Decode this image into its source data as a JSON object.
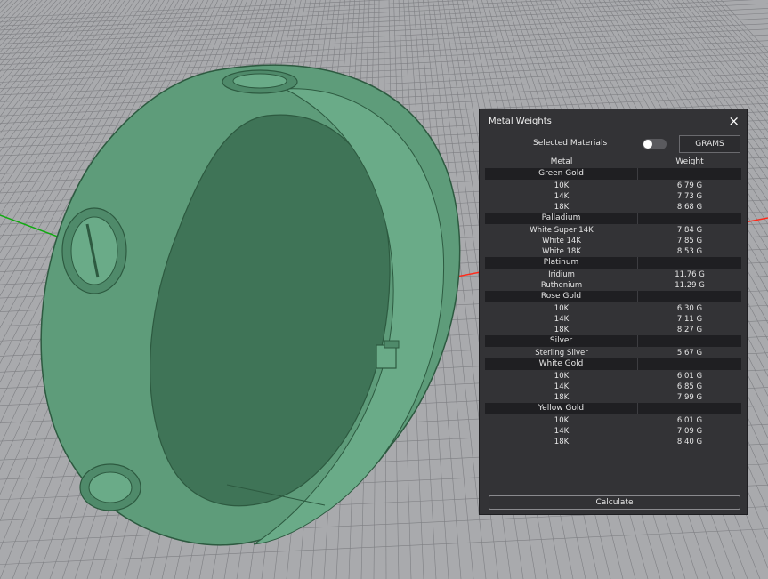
{
  "viewport": {
    "background": "#a9aaad",
    "grid_color": "#7e7f83",
    "ring_color": "#5e9c7a",
    "ring_outline": "#2d5a40",
    "axis_x_color": "#ff2a1a",
    "axis_y_color": "#11aa11"
  },
  "panel": {
    "title": "Metal Weights",
    "close_icon": "×",
    "selected_materials_label": "Selected Materials",
    "toggle_on": false,
    "units_button": "GRAMS",
    "header": {
      "metal": "Metal",
      "weight": "Weight"
    },
    "groups": [
      {
        "name": "Green Gold",
        "items": [
          {
            "metal": "10K",
            "weight": "6.79 G"
          },
          {
            "metal": "14K",
            "weight": "7.73 G"
          },
          {
            "metal": "18K",
            "weight": "8.68 G"
          }
        ]
      },
      {
        "name": "Palladium",
        "items": [
          {
            "metal": "White Super 14K",
            "weight": "7.84 G"
          },
          {
            "metal": "White 14K",
            "weight": "7.85 G"
          },
          {
            "metal": "White 18K",
            "weight": "8.53 G"
          }
        ]
      },
      {
        "name": "Platinum",
        "items": [
          {
            "metal": "Iridium",
            "weight": "11.76 G"
          },
          {
            "metal": "Ruthenium",
            "weight": "11.29 G"
          }
        ]
      },
      {
        "name": "Rose Gold",
        "items": [
          {
            "metal": "10K",
            "weight": "6.30 G"
          },
          {
            "metal": "14K",
            "weight": "7.11 G"
          },
          {
            "metal": "18K",
            "weight": "8.27 G"
          }
        ]
      },
      {
        "name": "Silver",
        "items": [
          {
            "metal": "Sterling Silver",
            "weight": "5.67 G"
          }
        ]
      },
      {
        "name": "White Gold",
        "items": [
          {
            "metal": "10K",
            "weight": "6.01 G"
          },
          {
            "metal": "14K",
            "weight": "6.85 G"
          },
          {
            "metal": "18K",
            "weight": "7.99 G"
          }
        ]
      },
      {
        "name": "Yellow Gold",
        "items": [
          {
            "metal": "10K",
            "weight": "6.01 G"
          },
          {
            "metal": "14K",
            "weight": "7.09 G"
          },
          {
            "metal": "18K",
            "weight": "8.40 G"
          }
        ]
      }
    ],
    "calculate_button": "Calculate"
  }
}
